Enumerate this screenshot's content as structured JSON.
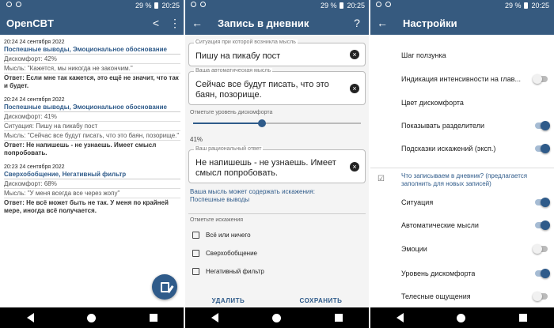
{
  "status": {
    "time": "20:25",
    "battery": "29 %"
  },
  "screen1": {
    "title": "OpenCBT",
    "entries": [
      {
        "time": "20:24 24 сентября 2022",
        "distortions": "Поспешные выводы, Эмоциональное обоснование",
        "discomfort": "Дискомфорт: 42%",
        "thought": "Мысль: \"Кажется, мы никогда не закончим.\"",
        "answer": "Ответ: Если мне так кажется, это ещё не значит, что так и будет."
      },
      {
        "time": "20:24 24 сентября 2022",
        "distortions": "Поспешные выводы, Эмоциональное обоснование",
        "discomfort": "Дискомфорт: 41%",
        "situation": "Ситуация: Пишу на пикабу пост",
        "thought": "Мысль: \"Сейчас все будут писать, что это баян, позорище.\"",
        "answer": "Ответ: Не напишешь - не узнаешь. Имеет смысл попробовать."
      },
      {
        "time": "20:23 24 сентября 2022",
        "distortions": "Сверхобобщение, Негативный фильтр",
        "discomfort": "Дискомфорт: 68%",
        "thought": "Мысль: \"У меня всегда все через жопу\"",
        "answer": "Ответ: Не всё может быть не так. У меня по крайней мере, иногда всё получается."
      }
    ]
  },
  "screen2": {
    "title": "Запись в дневник",
    "situation_label": "Ситуация при которой возникла мысль",
    "situation_value": "Пишу на пикабу пост",
    "thought_label": "Ваша автоматическая мысль",
    "thought_value": "Сейчас все будут писать, что это баян, позорище.",
    "slider_label": "Отметьте уровень дискомфорта",
    "discomfort_value": 0.41,
    "discomfort_pct": "41%",
    "answer_label": "Ваш рациональный ответ",
    "answer_value": "Не напишешь - не узнаешь. Имеет смысл попробовать.",
    "warning_line1": "Ваша мысль может содержать искажения:",
    "warning_line2": "Поспешные выводы",
    "distortions_label": "Отметьте искажения",
    "checkboxes": [
      "Всё или ничего",
      "Сверхобобщение",
      "Негативный фильтр"
    ],
    "delete_label": "УДАЛИТЬ",
    "save_label": "СОХРАНИТЬ"
  },
  "screen3": {
    "title": "Настройки",
    "rows": [
      {
        "label": "Шаг ползунка",
        "toggle": null
      },
      {
        "label": "Индикация интенсивности на глав...",
        "toggle": false
      },
      {
        "label": "Цвет дискомфорта",
        "toggle": null
      },
      {
        "label": "Показывать разделители",
        "toggle": true
      },
      {
        "label": "Подсказки искажений (эксп.)",
        "toggle": true
      }
    ],
    "section_text": "Что записываем в дневник? (предлагается заполнить для новых записей)",
    "rows2": [
      {
        "label": "Ситуация",
        "toggle": true
      },
      {
        "label": "Автоматические мысли",
        "toggle": true
      },
      {
        "label": "Эмоции",
        "toggle": false
      },
      {
        "label": "Уровень дискомфорта",
        "toggle": true
      },
      {
        "label": "Телесные ощущения",
        "toggle": false
      }
    ]
  },
  "colors": {
    "primary": "#365a7f",
    "accent": "#2f5b8a"
  }
}
